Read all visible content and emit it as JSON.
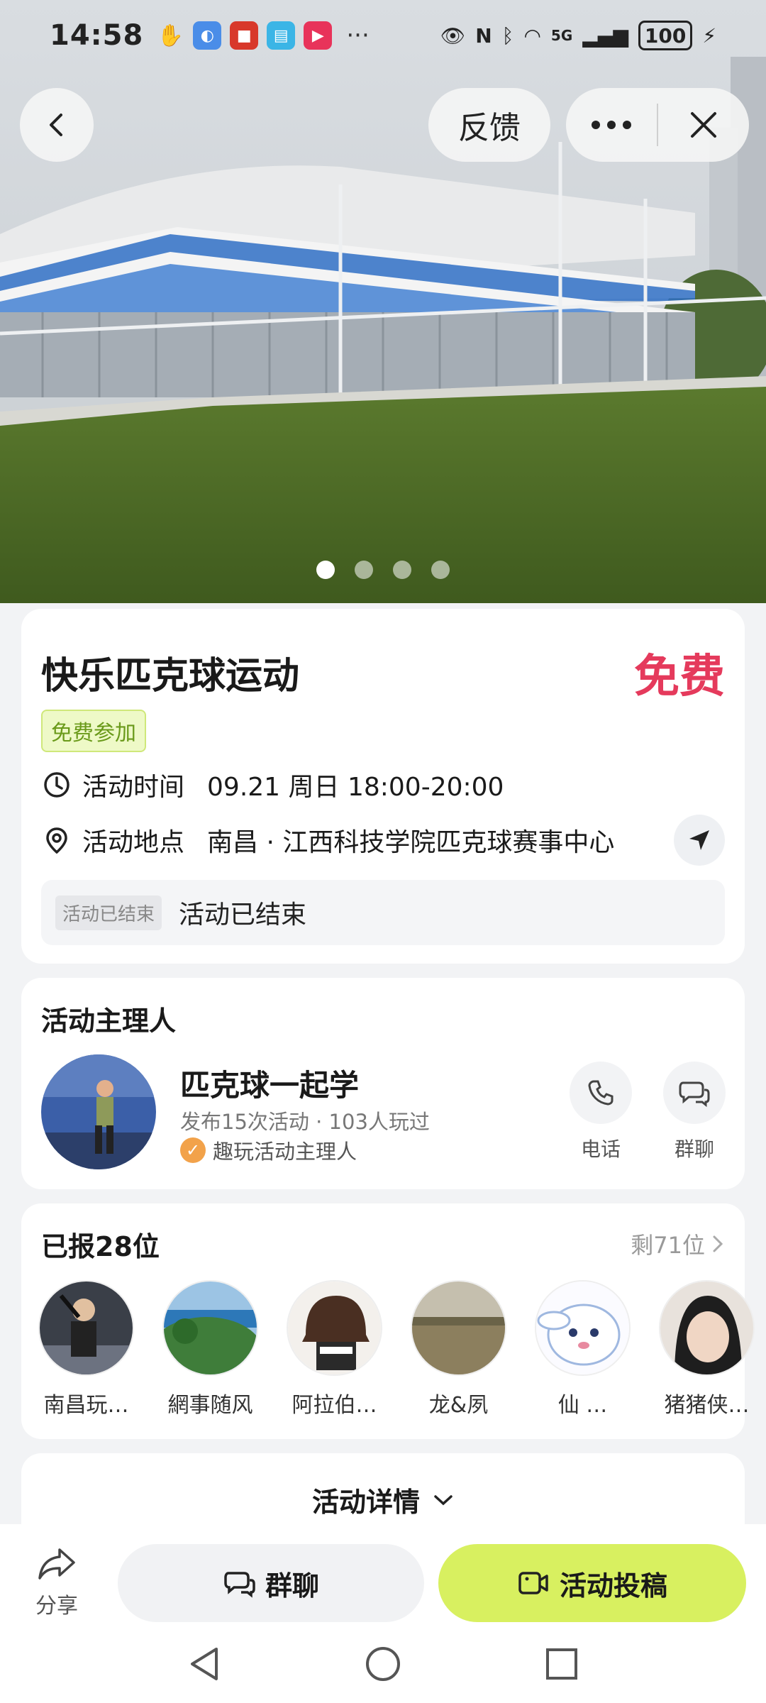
{
  "status_bar": {
    "time": "14:58",
    "dots": "···",
    "network": "5G",
    "battery": "100"
  },
  "nav": {
    "feedback_label": "反馈"
  },
  "carousel": {
    "total": 4,
    "active": 1
  },
  "event": {
    "title": "快乐匹克球运动",
    "price": "免费",
    "tag": "免费参加",
    "time_label": "活动时间",
    "time_value": "09.21 周日 18:00-20:00",
    "location_label": "活动地点",
    "location_value": "南昌 · 江西科技学院匹克球赛事中心",
    "status_tag": "活动已结束",
    "status_text": "活动已结束"
  },
  "host": {
    "section_title": "活动主理人",
    "name": "匹克球一起学",
    "stats": "发布15次活动 · 103人玩过",
    "badge": "趣玩活动主理人",
    "phone_label": "电话",
    "chat_label": "群聊"
  },
  "signed": {
    "title": "已报28位",
    "remaining": "剩71位",
    "members": [
      {
        "name": "南昌玩…"
      },
      {
        "name": "網事随风"
      },
      {
        "name": "阿拉伯…"
      },
      {
        "name": "龙&夙"
      },
      {
        "name": "仙 …"
      },
      {
        "name": "猪猪侠…"
      }
    ]
  },
  "detail": {
    "label": "活动详情"
  },
  "bottom": {
    "share_label": "分享",
    "group_chat_label": "群聊",
    "submit_label": "活动投稿"
  },
  "colors": {
    "price": "#e53a5c",
    "accent_green": "#d8f060",
    "tag_green": "#6a9a1a"
  }
}
